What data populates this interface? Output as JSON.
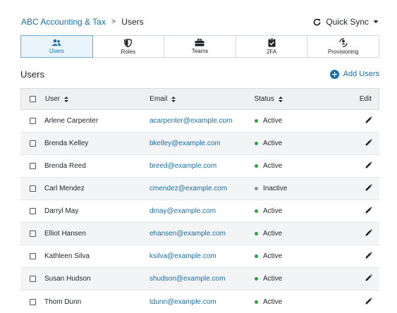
{
  "breadcrumb": {
    "parent": "ABC Accounting & Tax",
    "separator": ">",
    "current": "Users"
  },
  "quick_sync": {
    "label": "Quick Sync"
  },
  "tabs": [
    {
      "label": "Users",
      "icon": "users-icon",
      "active": true
    },
    {
      "label": "Roles",
      "icon": "shield-icon",
      "active": false
    },
    {
      "label": "Teams",
      "icon": "briefcase-icon",
      "active": false
    },
    {
      "label": "2FA",
      "icon": "clipboard-check-icon",
      "active": false
    },
    {
      "label": "Provisioning",
      "icon": "provisioning-icon",
      "active": false
    }
  ],
  "section": {
    "title": "Users",
    "add_label": "Add Users"
  },
  "table": {
    "columns": {
      "user": "User",
      "email": "Email",
      "status": "Status",
      "edit": "Edit"
    },
    "rows": [
      {
        "user": "Arlene Carpenter",
        "email": "acarpenter@example.com",
        "status": "Active"
      },
      {
        "user": "Brenda Kelley",
        "email": "bkelley@example.com",
        "status": "Active"
      },
      {
        "user": "Brenda Reed",
        "email": "breed@example.com",
        "status": "Active"
      },
      {
        "user": "Carl Mendez",
        "email": "cmendez@example.com",
        "status": "Inactive"
      },
      {
        "user": "Darryl May",
        "email": "dmay@example.com",
        "status": "Active"
      },
      {
        "user": "Elliot Hansen",
        "email": "ehansen@example.com",
        "status": "Active"
      },
      {
        "user": "Kathleen Silva",
        "email": "ksilva@example.com",
        "status": "Active"
      },
      {
        "user": "Susan Hudson",
        "email": "shudson@example.com",
        "status": "Active"
      },
      {
        "user": "Thom Dunn",
        "email": "tdunn@example.com",
        "status": "Active"
      }
    ]
  },
  "colors": {
    "accent": "#1b6fa8",
    "active_status": "#2e9e4a",
    "inactive_status": "#8a8f94",
    "header_bg": "#eef0f2",
    "alt_row_bg": "#f3f4f5"
  }
}
